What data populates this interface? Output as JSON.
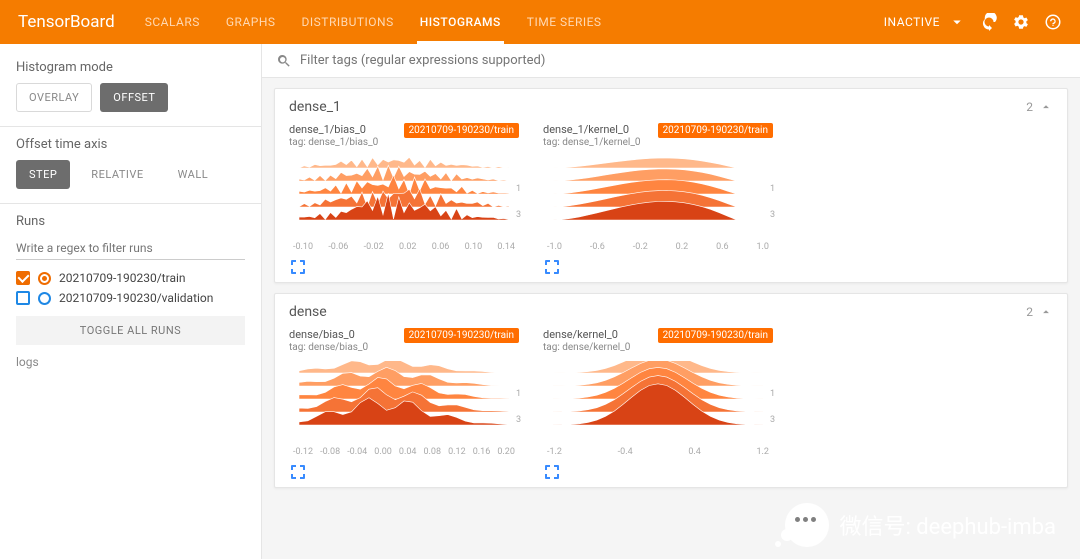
{
  "brand": "TensorBoard",
  "tabs": [
    "SCALARS",
    "GRAPHS",
    "DISTRIBUTIONS",
    "HISTOGRAMS",
    "TIME SERIES"
  ],
  "active_tab": 3,
  "inactive_label": "INACTIVE",
  "sidebar": {
    "histogram_mode": {
      "title": "Histogram mode",
      "options": [
        "OVERLAY",
        "OFFSET"
      ],
      "selected": 1
    },
    "offset_axis": {
      "title": "Offset time axis",
      "options": [
        "STEP",
        "RELATIVE",
        "WALL"
      ],
      "selected": 0
    },
    "runs_title": "Runs",
    "runs_placeholder": "Write a regex to filter runs",
    "runs": [
      {
        "name": "20210709-190230/train",
        "checked": true,
        "color": "#ef6c00"
      },
      {
        "name": "20210709-190230/validation",
        "checked": false,
        "color": "#1e88e5"
      }
    ],
    "toggle_label": "TOGGLE ALL RUNS",
    "logs_label": "logs"
  },
  "filter_placeholder": "Filter tags (regular expressions supported)",
  "groups": [
    {
      "name": "dense_1",
      "count": "2",
      "cards": [
        {
          "title": "dense_1/bias_0",
          "tag": "tag: dense_1/bias_0",
          "run": "20210709-190230/train",
          "x": [
            "-0.10",
            "-0.06",
            "-0.02",
            "0.02",
            "0.06",
            "0.10",
            "0.14"
          ],
          "yticks": [
            "1",
            "3"
          ],
          "shape": "spikes"
        },
        {
          "title": "dense_1/kernel_0",
          "tag": "tag: dense_1/kernel_0",
          "run": "20210709-190230/train",
          "x": [
            "-1.0",
            "-0.6",
            "-0.2",
            "0.2",
            "0.6",
            "1.0"
          ],
          "yticks": [
            "1",
            "3"
          ],
          "shape": "right"
        }
      ]
    },
    {
      "name": "dense",
      "count": "2",
      "cards": [
        {
          "title": "dense/bias_0",
          "tag": "tag: dense/bias_0",
          "run": "20210709-190230/train",
          "x": [
            "-0.12",
            "-0.08",
            "-0.04",
            "0.00",
            "0.04",
            "0.08",
            "0.12",
            "0.16",
            "0.20"
          ],
          "yticks": [
            "1",
            "3"
          ],
          "shape": "broad"
        },
        {
          "title": "dense/kernel_0",
          "tag": "tag: dense/kernel_0",
          "run": "20210709-190230/train",
          "x": [
            "-1.2",
            "-0.4",
            "0.4",
            "1.2"
          ],
          "yticks": [
            "1",
            "3"
          ],
          "shape": "center"
        }
      ]
    }
  ],
  "watermark": "微信号: deephub-imba"
}
